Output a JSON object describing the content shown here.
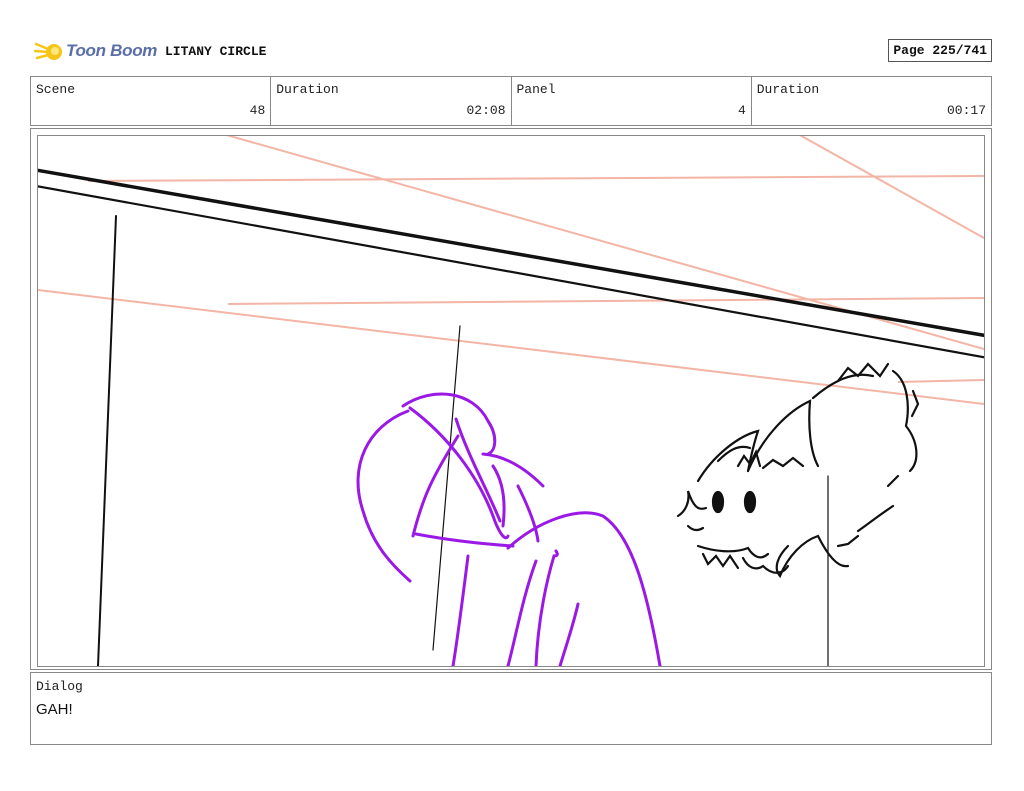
{
  "header": {
    "logo_text": "Toon Boom",
    "project_title": "LITANY CIRCLE",
    "page_label": "Page 225/741"
  },
  "info": {
    "scene_label": "Scene",
    "scene_value": "48",
    "duration_label": "Duration",
    "duration_value": "02:08",
    "panel_label": "Panel",
    "panel_value": "4",
    "panel_duration_label": "Duration",
    "panel_duration_value": "00:17"
  },
  "dialog": {
    "label": "Dialog",
    "text": "GAH!"
  },
  "colors": {
    "logo_blue": "#5a6ea8",
    "logo_yellow": "#f5c518",
    "sketch_purple": "#9b19e6",
    "sketch_guide": "#f3b5a5",
    "sketch_ink": "#111111"
  }
}
